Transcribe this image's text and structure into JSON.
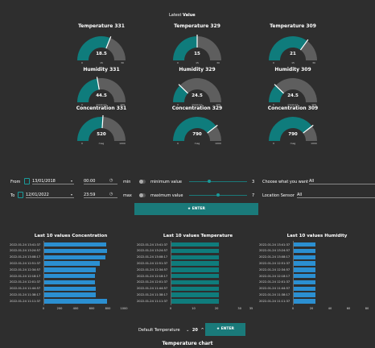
{
  "header": {
    "latest_prefix": "Latest",
    "latest_value": "Value"
  },
  "gauges": [
    {
      "title": "Temperature 331",
      "value": "18.5",
      "min": "0",
      "max": "30",
      "mid": "15",
      "fraction": 0.62
    },
    {
      "title": "Temperature 329",
      "value": "15",
      "min": "0",
      "max": "30",
      "mid": "15",
      "fraction": 0.5
    },
    {
      "title": "Temperature 309",
      "value": "21",
      "min": "0",
      "max": "30",
      "mid": "15",
      "fraction": 0.7
    },
    {
      "title": "Humidity 331",
      "value": "44.5",
      "min": "0",
      "max": "100",
      "mid": "measure",
      "fraction": 0.445
    },
    {
      "title": "Humidity 329",
      "value": "24.5",
      "min": "0",
      "max": "100",
      "mid": "measure",
      "fraction": 0.245
    },
    {
      "title": "Humidity 309",
      "value": "24.5",
      "min": "0",
      "max": "100",
      "mid": "measure",
      "fraction": 0.245
    },
    {
      "title": "Concentration 331",
      "value": "520",
      "min": "0",
      "max": "1000",
      "mid": "mag",
      "fraction": 0.52
    },
    {
      "title": "Concentration 329",
      "value": "790",
      "min": "0",
      "max": "1000",
      "mid": "mag",
      "fraction": 0.79
    },
    {
      "title": "Concentration 309",
      "value": "790",
      "min": "0",
      "max": "1000",
      "mid": "mag",
      "fraction": 0.79
    }
  ],
  "filters": {
    "from_label": "From",
    "from_date": "13/01/2018",
    "from_time": "00:00",
    "to_label": "To",
    "to_date": "12/01/2022",
    "to_time": "23:59",
    "min_label": "min",
    "max_label": "max",
    "minimum_label": "minimum value",
    "minimum_value": "3",
    "minimum_fraction": 0.35,
    "maximum_label": "maximum value",
    "maximum_value": "7",
    "maximum_fraction": 0.5,
    "choose_label": "Choose what you want",
    "choose_value": "All",
    "location_label": "Location Sensor",
    "location_value": "All",
    "enter_label": "ENTER"
  },
  "charts": {
    "labels": [
      "2022-01-24 13:41:37",
      "2022-01-24 13:24:57",
      "2022-01-24 13:08:17",
      "2022-01-24 12:51:37",
      "2022-01-24 12:34:57",
      "2022-01-24 12:18:17",
      "2022-01-24 12:01:37",
      "2022-01-24 11:44:57",
      "2022-01-24 11:38:17",
      "2022-01-24 11:11:37"
    ],
    "concentration": {
      "title": "Last 10 values Concentration",
      "ticks": [
        "0",
        "200",
        "400",
        "600",
        "800",
        "1000"
      ],
      "max": 1000,
      "values": [
        780,
        790,
        770,
        700,
        650,
        640,
        640,
        650,
        650,
        790
      ]
    },
    "temperature": {
      "title": "Last 10 values Temperature",
      "ticks": [
        "0",
        "10",
        "20",
        "30",
        "35"
      ],
      "max": 35,
      "values": [
        21,
        21,
        21,
        21,
        21,
        21,
        21,
        21,
        21,
        21
      ]
    },
    "humidity": {
      "title": "Last 10 values Humidity",
      "ticks": [
        "0",
        "20",
        "40",
        "60",
        "80"
      ],
      "max": 80,
      "values": [
        24.5,
        24.5,
        24.5,
        24.5,
        24.5,
        24.5,
        24.5,
        24.5,
        24.5,
        24.5
      ]
    }
  },
  "colors": {
    "teal": "#0f7c7c",
    "gray": "#5e5e5e",
    "bar_blue": "#2b8fd1",
    "bar_teal": "#0f7c7c"
  },
  "bottom": {
    "default_label": "Default Temperature",
    "count": "20",
    "enter_label": "ENTER",
    "chart_title": "Temperature chart"
  }
}
